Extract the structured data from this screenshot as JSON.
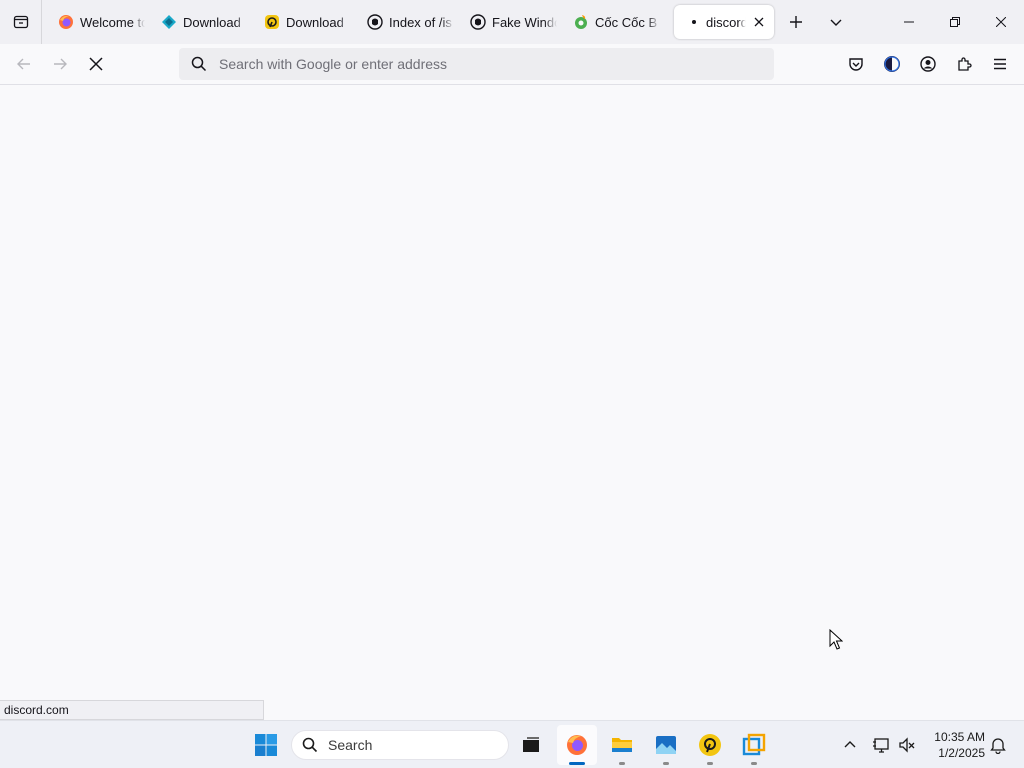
{
  "browser": {
    "tabs": [
      {
        "title": "Welcome to",
        "icon": "firefox-icon"
      },
      {
        "title": "Download",
        "icon": "diamond-icon"
      },
      {
        "title": "Download",
        "icon": "anydesk-icon"
      },
      {
        "title": "Index of /is",
        "icon": "github-icon"
      },
      {
        "title": "Fake Windo",
        "icon": "github-icon"
      },
      {
        "title": "Cốc Cốc B",
        "icon": "coccoc-icon"
      }
    ],
    "active_tab": {
      "title": "discord.",
      "icon": "loading-dot-icon"
    },
    "url_placeholder": "Search with Google or enter address",
    "url_value": "",
    "status_text": "discord.com"
  },
  "taskbar": {
    "search_label": "Search",
    "apps": [
      "task-view",
      "firefox",
      "file-explorer",
      "photos",
      "anydesk",
      "vmware"
    ],
    "clock_time": "10:35 AM",
    "clock_date": "1/2/2025"
  },
  "colors": {
    "accent": "#0067c0",
    "tab_bg": "#f0f0f4",
    "page_bg": "#f9f9fb"
  }
}
